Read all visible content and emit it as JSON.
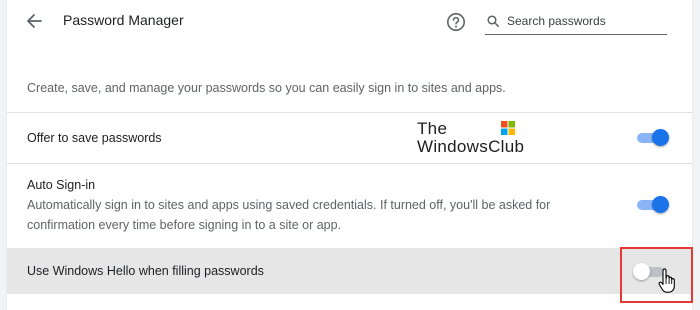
{
  "header": {
    "title": "Password Manager",
    "search_placeholder": "Search passwords",
    "back_icon": "arrow-left-icon",
    "help_icon": "help-circle-icon",
    "search_icon": "search-icon"
  },
  "description": "Create, save, and manage your passwords so you can easily sign in to sites and apps.",
  "settings": [
    {
      "label": "Offer to save passwords",
      "enabled": true
    },
    {
      "label": "Auto Sign-in",
      "sublabel_line1": "Automatically sign in to sites and apps using saved credentials. If turned off, you'll be asked for",
      "sublabel_line2": "confirmation every time before signing in to a site or app.",
      "enabled": true
    },
    {
      "label": "Use Windows Hello when filling passwords",
      "enabled": false
    }
  ],
  "watermark": {
    "line1": "The",
    "line2": "WindowsClub"
  },
  "colors": {
    "toggle_on": "#1a73e8",
    "toggle_on_track": "#8ab4f8",
    "highlight": "#e53935",
    "hover_row": "#e6e6e6"
  }
}
